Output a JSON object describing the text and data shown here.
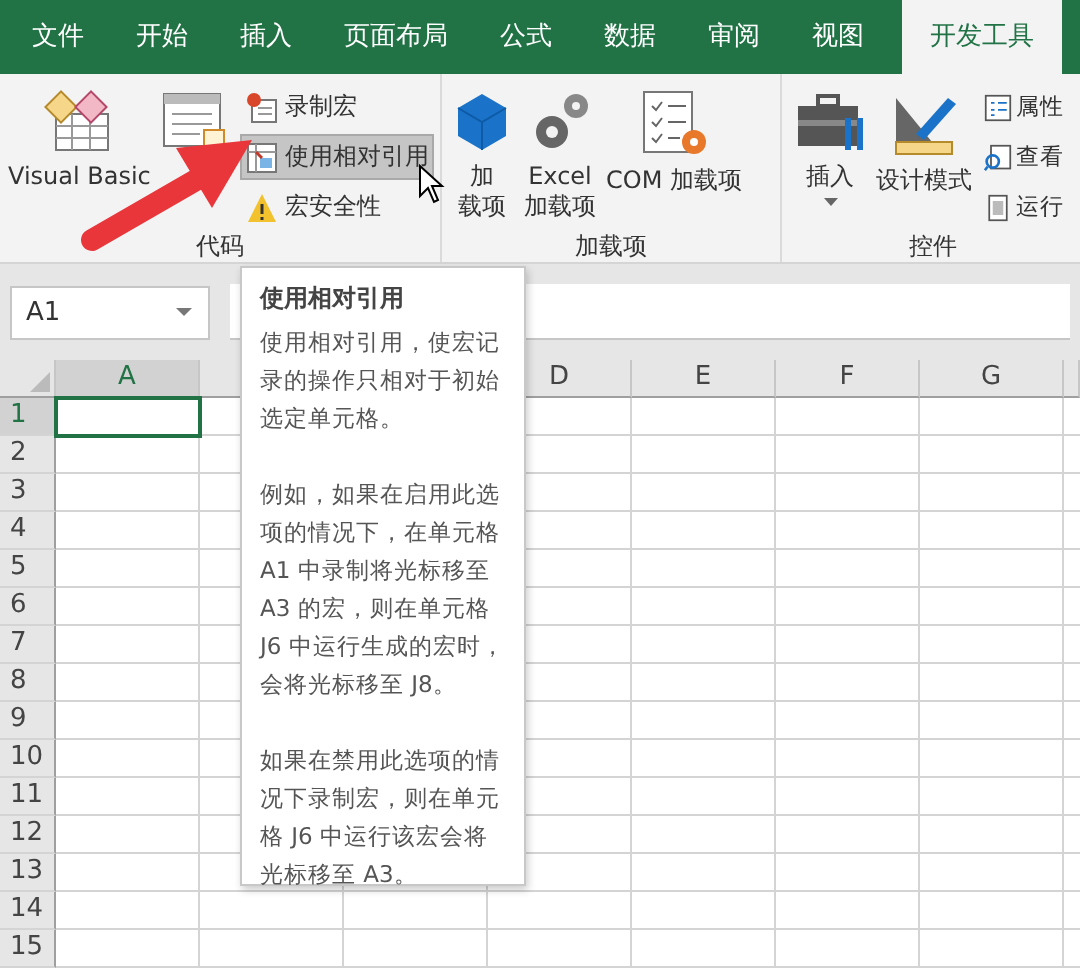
{
  "tabs": [
    {
      "label": "文件",
      "selected": false
    },
    {
      "label": "开始",
      "selected": false
    },
    {
      "label": "插入",
      "selected": false
    },
    {
      "label": "页面布局",
      "selected": false
    },
    {
      "label": "公式",
      "selected": false
    },
    {
      "label": "数据",
      "selected": false
    },
    {
      "label": "审阅",
      "selected": false
    },
    {
      "label": "视图",
      "selected": false
    },
    {
      "label": "开发工具",
      "selected": true
    }
  ],
  "groups": [
    {
      "label": "代码",
      "items": [
        {
          "kind": "large",
          "lines": [
            "Visual Basic"
          ]
        },
        {
          "kind": "large"
        },
        {
          "kind": "stack",
          "items": [
            {
              "label": "录制宏",
              "selected": false
            },
            {
              "label": "使用相对引用",
              "selected": true
            },
            {
              "label": "宏安全性",
              "selected": false
            }
          ]
        }
      ]
    },
    {
      "label": "加载项",
      "items": [
        {
          "kind": "large",
          "lines": [
            "加",
            "载项"
          ]
        },
        {
          "kind": "large",
          "lines": [
            "Excel",
            "加载项"
          ]
        },
        {
          "kind": "large",
          "lines": [
            "COM 加载项"
          ]
        }
      ]
    },
    {
      "label": "控件",
      "items": [
        {
          "kind": "large",
          "lines": [
            "插入"
          ],
          "dropdown": true
        },
        {
          "kind": "large",
          "lines": [
            "设计模式"
          ]
        },
        {
          "kind": "stack",
          "items": [
            {
              "label": "属性",
              "selected": false
            },
            {
              "label": "查看",
              "selected": false
            },
            {
              "label": "运行",
              "selected": false
            }
          ]
        }
      ]
    }
  ],
  "name_box": {
    "value": "A1"
  },
  "columns": [
    {
      "label": "A",
      "selected": true
    },
    {
      "selected": false
    },
    {
      "label": "D",
      "selected": false
    },
    {
      "label": "E",
      "selected": false
    },
    {
      "label": "F",
      "selected": false
    },
    {
      "label": "G",
      "selected": false
    }
  ],
  "rows": [
    {
      "label": "1",
      "selected": true
    },
    {
      "label": "2",
      "selected": false
    },
    {
      "label": "3",
      "selected": false
    },
    {
      "label": "4",
      "selected": false
    },
    {
      "label": "5",
      "selected": false
    },
    {
      "label": "6",
      "selected": false
    },
    {
      "label": "7",
      "selected": false
    },
    {
      "label": "8",
      "selected": false
    },
    {
      "label": "9",
      "selected": false
    },
    {
      "label": "10",
      "selected": false
    },
    {
      "label": "11",
      "selected": false
    },
    {
      "label": "12",
      "selected": false
    },
    {
      "label": "13",
      "selected": false
    },
    {
      "label": "14",
      "selected": false
    },
    {
      "label": "15",
      "selected": false
    }
  ],
  "tooltip": {
    "title": "使用相对引用",
    "paragraphs": [
      "使用相对引用，使宏记录的操作只相对于初始选定单元格。",
      "例如，如果在启用此选项的情况下，在单元格 A1 中录制将光标移至 A3 的宏，则在单元格 J6 中运行生成的宏时，会将光标移至 J8。",
      "如果在禁用此选项的情况下录制宏，则在单元格 J6 中运行该宏会将光标移至 A3。"
    ]
  }
}
